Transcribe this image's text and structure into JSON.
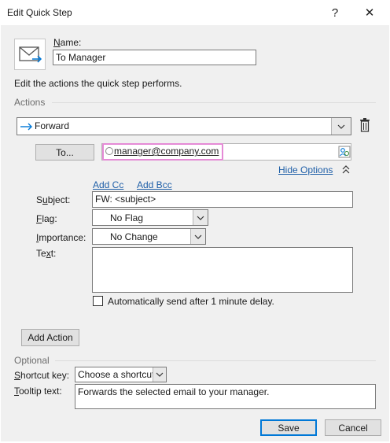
{
  "window": {
    "title": "Edit Quick Step",
    "help": "?",
    "close": "✕"
  },
  "name": {
    "label": "Name:",
    "value": "To Manager"
  },
  "description": "Edit the actions the quick step performs.",
  "actions": {
    "section_label": "Actions",
    "action_name": "Forward",
    "to_button": "To...",
    "to_value": "manager@company.com",
    "hide_options": "Hide Options",
    "add_cc": "Add Cc",
    "add_bcc": "Add Bcc",
    "subject_label": "Subject:",
    "subject_value": "FW: <subject>",
    "flag_label": "Flag:",
    "flag_value": "No Flag",
    "importance_label": "Importance:",
    "importance_value": "No Change",
    "text_label": "Text:",
    "text_value": "",
    "auto_send_label": "Automatically send after 1 minute delay.",
    "add_action": "Add Action"
  },
  "optional": {
    "section_label": "Optional",
    "shortcut_label": "Shortcut key:",
    "shortcut_value": "Choose a shortcut",
    "tooltip_label": "Tooltip text:",
    "tooltip_value": "Forwards the selected email to your manager."
  },
  "footer": {
    "save": "Save",
    "cancel": "Cancel"
  }
}
